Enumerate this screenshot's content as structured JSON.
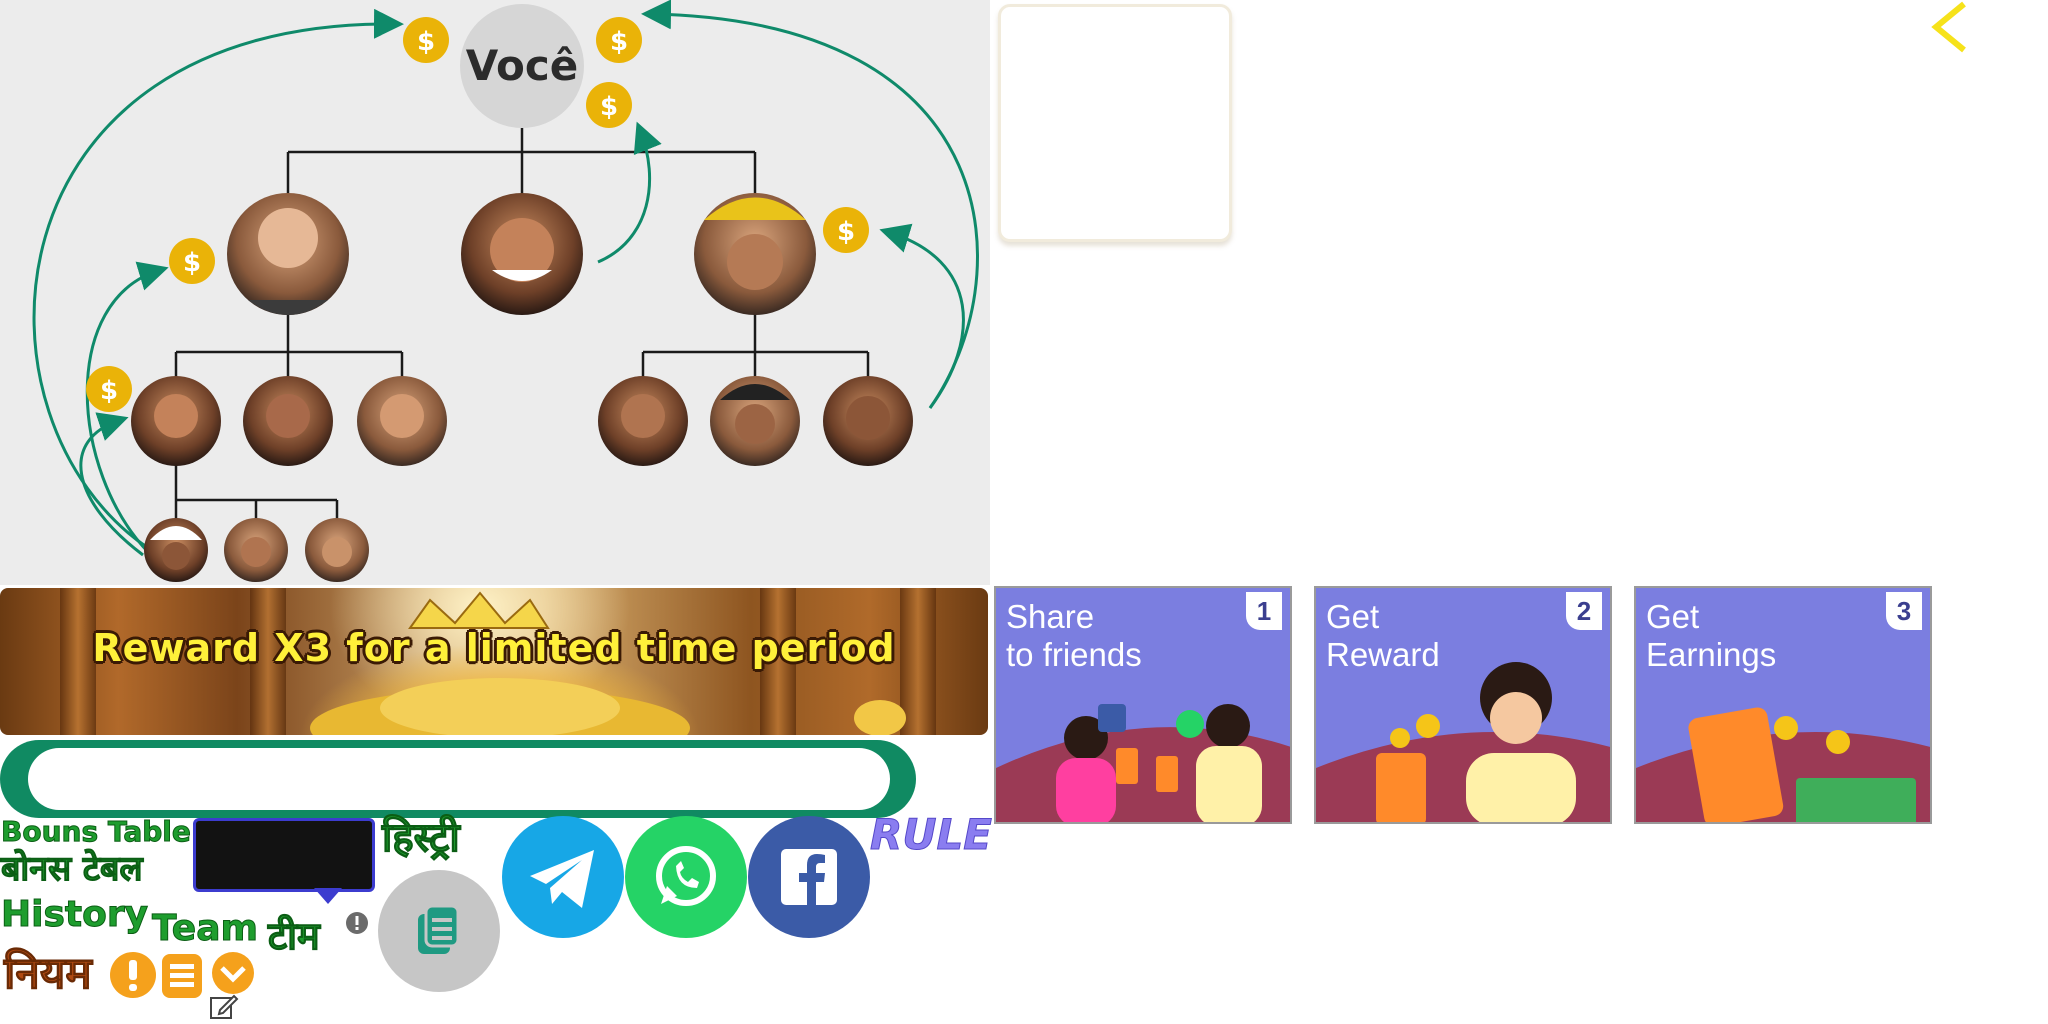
{
  "tree": {
    "root_label": "Você",
    "coin_symbol": "$"
  },
  "banner": {
    "text": "Reward X3 for a limited time period"
  },
  "link_input": {
    "value": "",
    "placeholder": ""
  },
  "labels": {
    "bonus_table_en": "Bouns Table",
    "bonus_table_hi": "बोनस टेबल",
    "history_hi": "हिस्ट्री",
    "history_en": "History",
    "team_en": "Team",
    "team_hi": "टीम",
    "rules_hi": "नियम",
    "rule_en": "RULE"
  },
  "share": {
    "telegram": "telegram-icon",
    "whatsapp": "whatsapp-icon",
    "facebook": "facebook-icon",
    "copy": "copy-icon"
  },
  "steps": [
    {
      "number": "1",
      "title": "Share\nto friends"
    },
    {
      "number": "2",
      "title": "Get\nReward"
    },
    {
      "number": "3",
      "title": "Get\nEarnings"
    }
  ],
  "colors": {
    "brand_green": "#108a62",
    "coin_yellow": "#eab308",
    "rule_purple": "#8a7df0",
    "card_purple": "#7b7ee0",
    "back_yellow": "#f6e21a"
  }
}
